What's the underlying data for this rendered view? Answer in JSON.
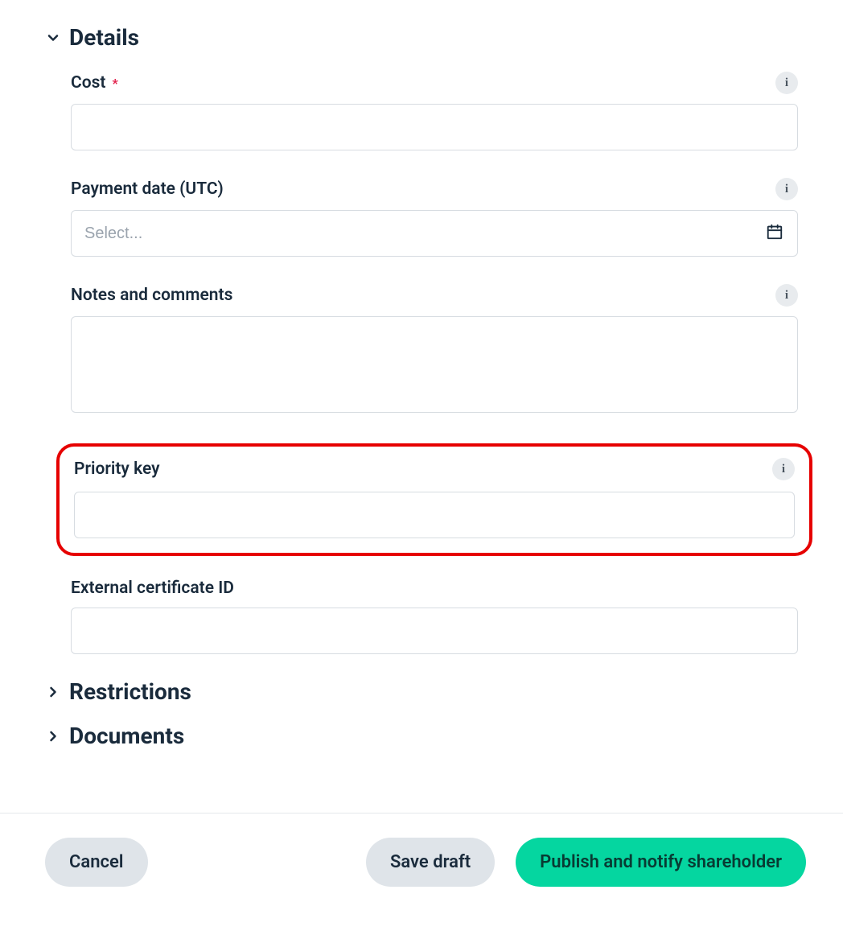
{
  "sections": {
    "details": {
      "title": "Details"
    },
    "restrictions": {
      "title": "Restrictions"
    },
    "documents": {
      "title": "Documents"
    }
  },
  "fields": {
    "cost": {
      "label": "Cost",
      "required_marker": "*",
      "value": ""
    },
    "payment_date": {
      "label": "Payment date (UTC)",
      "placeholder": "Select...",
      "value": ""
    },
    "notes": {
      "label": "Notes and comments",
      "value": ""
    },
    "priority_key": {
      "label": "Priority key",
      "value": ""
    },
    "external_cert": {
      "label": "External certificate ID",
      "value": ""
    }
  },
  "info_glyph": "i",
  "footer": {
    "cancel": "Cancel",
    "save_draft": "Save draft",
    "publish": "Publish and notify shareholder"
  }
}
